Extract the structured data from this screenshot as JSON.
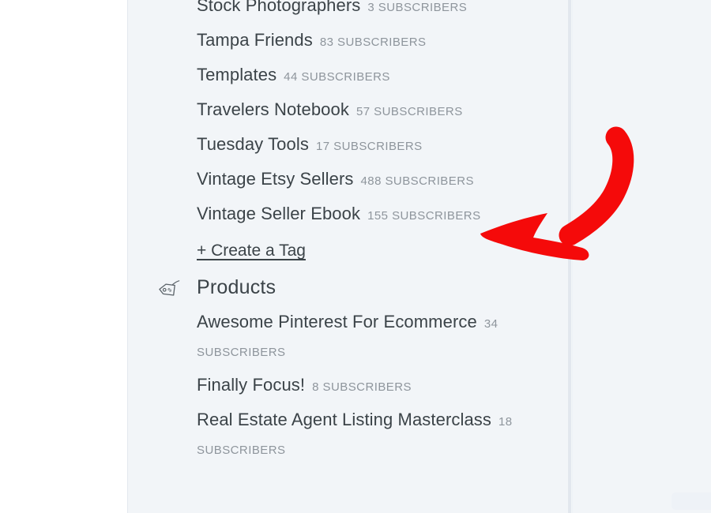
{
  "colors": {
    "panel_background": "#f2f5f8",
    "page_background": "#ffffff",
    "title_text": "#3b4348",
    "meta_text": "#8e959c",
    "annotation_red": "#f50a0a",
    "divider": "#e2e7ee"
  },
  "tags": {
    "items": [
      {
        "name": "Stock Photographers",
        "meta": "3 SUBSCRIBERS"
      },
      {
        "name": "Tampa Friends",
        "meta": "83 SUBSCRIBERS"
      },
      {
        "name": "Templates",
        "meta": "44 SUBSCRIBERS"
      },
      {
        "name": "Travelers Notebook",
        "meta": "57 SUBSCRIBERS"
      },
      {
        "name": "Tuesday Tools",
        "meta": "17 SUBSCRIBERS"
      },
      {
        "name": "Vintage Etsy Sellers",
        "meta": "488 SUBSCRIBERS"
      },
      {
        "name": "Vintage Seller Ebook",
        "meta": "155 SUBSCRIBERS"
      }
    ],
    "create_label": "+ Create a Tag"
  },
  "products": {
    "icon": "price-tag-icon",
    "title": "Products",
    "items": [
      {
        "name": "Awesome Pinterest For Ecommerce",
        "meta": "34 SUBSCRIBERS"
      },
      {
        "name": "Finally Focus!",
        "meta": "8 SUBSCRIBERS"
      },
      {
        "name": "Real Estate Agent Listing Masterclass",
        "meta": "18 SUBSCRIBERS"
      }
    ]
  },
  "annotation": {
    "type": "curved-arrow",
    "color": "#f50a0a",
    "points_to": "+ Create a Tag"
  }
}
